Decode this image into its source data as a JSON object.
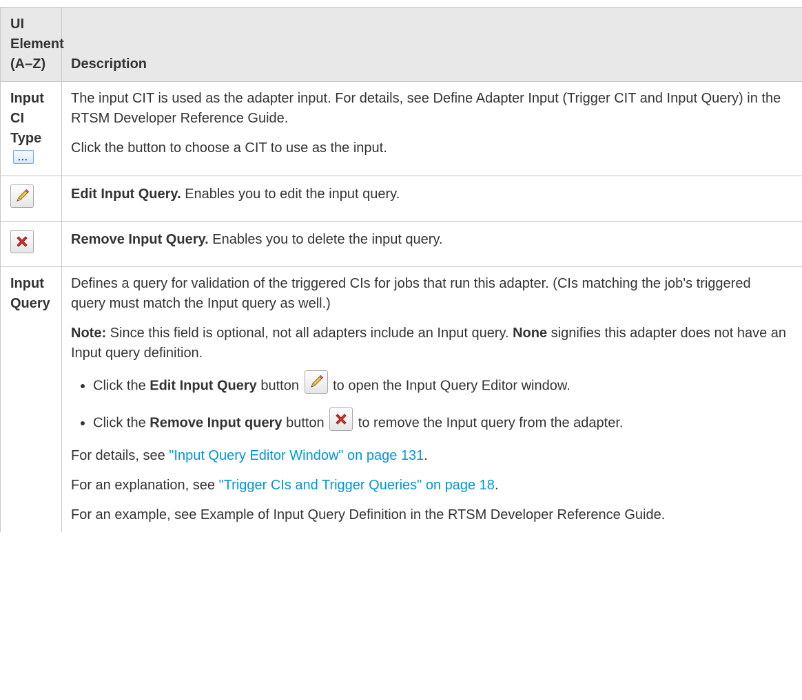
{
  "table": {
    "header": {
      "col_element": "UI Element (A–Z)",
      "col_element_line1": "UI",
      "col_element_line2": "Element",
      "col_element_line3": "(A–Z)",
      "col_description": "Description"
    },
    "rows": [
      {
        "element_line1": "Input CI",
        "element_line2": "Type",
        "icon": "browse-ellipsis-icon",
        "paragraphs": [
          "The input CIT is used as the adapter input. For details, see Define Adapter Input (Trigger CIT and Input Query) in the RTSM Developer Reference Guide.",
          "Click the button to choose a CIT to use as the input."
        ]
      },
      {
        "icon": "pencil-edit-icon",
        "title": "Edit Input Query.",
        "text": " Enables you to edit the input query."
      },
      {
        "icon": "red-x-remove-icon",
        "title": "Remove Input Query.",
        "text": " Enables you to delete the input query."
      },
      {
        "element_line1": "Input",
        "element_line2": "Query",
        "intro": "Defines a query for validation of the triggered CIs for jobs that run this adapter. (CIs matching the job's triggered query must match the Input query as well.)",
        "note": {
          "label": "Note:",
          "text1": " Since this field is optional, not all adapters include an Input query. ",
          "bold_none": "None",
          "text2": " signifies this adapter does not have an Input query definition."
        },
        "bullets": [
          {
            "prefix": "Click the ",
            "bold": "Edit Input Query",
            "mid": " button ",
            "icon": "pencil-edit-icon",
            "suffix": " to open the Input Query Editor window."
          },
          {
            "prefix": "Click the ",
            "bold": "Remove Input query",
            "mid": " button ",
            "icon": "red-x-remove-icon",
            "suffix": " to remove the Input query from the adapter."
          }
        ],
        "details": {
          "prefix": "For details, see ",
          "link": "\"Input Query Editor Window\" on page 131",
          "suffix": "."
        },
        "explanation": {
          "prefix": "For an explanation, see ",
          "link": "\"Trigger CIs and Trigger Queries\" on page 18",
          "suffix": "."
        },
        "example": "For an example, see Example of Input Query Definition in the RTSM Developer Reference Guide."
      }
    ]
  },
  "colors": {
    "header_bg": "#e8e8e8",
    "border": "#c8c8c8",
    "text": "#333333",
    "link": "#0096d6",
    "remove_icon_red": "#d9342b"
  }
}
